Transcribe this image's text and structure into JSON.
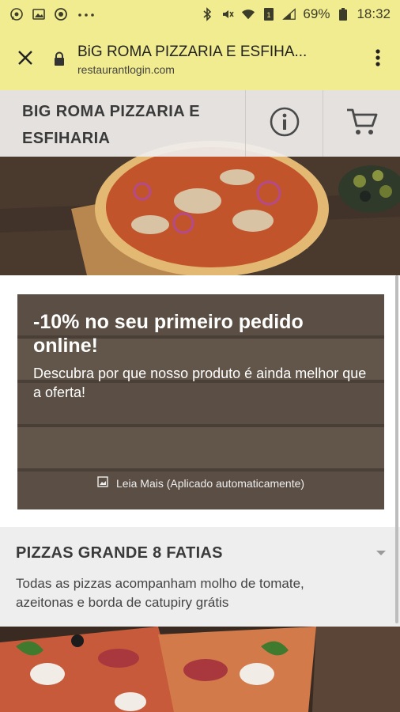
{
  "status_bar": {
    "battery": "69%",
    "time": "18:32",
    "icons": [
      "whatsapp-icon",
      "image-icon",
      "notification-icon",
      "more-dots-icon",
      "bluetooth-icon",
      "mute-icon",
      "wifi-icon",
      "sim1-icon",
      "signal-icon",
      "battery-icon"
    ]
  },
  "browser": {
    "page_title": "BiG ROMA PIZZARIA E ESFIHA...",
    "url": "restaurantlogin.com",
    "accent_color": "#f1ec8f"
  },
  "site": {
    "name_line1": "BIG ROMA PIZZARIA E",
    "name_line2": "ESFIHARIA"
  },
  "offer": {
    "title": "-10% no seu primeiro pedido online!",
    "description": "Descubra por que nosso produto é ainda melhor que a oferta!",
    "more_label": "Leia Mais (Aplicado automaticamente)"
  },
  "category": {
    "title": "PIZZAS GRANDE 8 FATIAS",
    "description": "Todas as pizzas acompanham molho de tomate, azeitonas e borda de catupiry grátis"
  }
}
